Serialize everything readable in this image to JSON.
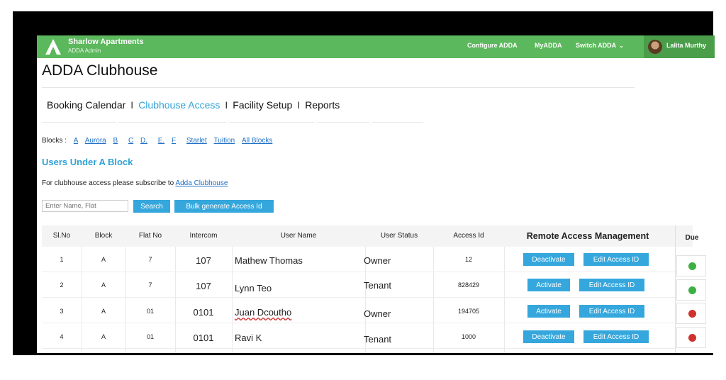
{
  "header": {
    "brand_name": "Sharlow Apartments",
    "brand_sub": "ADDA Admin",
    "nav": [
      "Configure ADDA",
      "MyADDA",
      "Switch ADDA"
    ],
    "user_name": "Lalita Murthy",
    "bar_color": "#5cb85c"
  },
  "page": {
    "title": "ADDA Clubhouse"
  },
  "tabs": [
    "Booking Calendar",
    "Clubhouse Access",
    "Facility Setup",
    "Reports"
  ],
  "tab_separator": "I",
  "active_tab": "Clubhouse Access",
  "blocks": {
    "label": "Blocks :",
    "items": [
      "A",
      "Aurora",
      "B",
      "C",
      "D.",
      "E.",
      "F",
      "Starlet",
      "Tuition",
      "All Blocks"
    ]
  },
  "section_title": "Users Under A Block",
  "subscribe": {
    "text": "For clubhouse access please subscribe to",
    "link": "Adda Clubhouse"
  },
  "search": {
    "placeholder": "Enter Name, Flat",
    "button": "Search",
    "bulk_button": "Bulk generate Access Id"
  },
  "table": {
    "columns": [
      "Sl.No",
      "Block",
      "Flat No",
      "Intercom",
      "User Name",
      "User Status",
      "Access Id",
      "Remote Access Management"
    ],
    "due_label": "Due",
    "edit_label": "Edit Access ID",
    "rows": [
      {
        "sl": "1",
        "block": "A",
        "flat": "7",
        "intercom": "107",
        "name": "Mathew Thomas",
        "status": "Owner",
        "access_id": "12",
        "action": "Deactivate",
        "due": "green"
      },
      {
        "sl": "2",
        "block": "A",
        "flat": "7",
        "intercom": "107",
        "name": "Lynn Teo",
        "status": "Tenant",
        "access_id": "828429",
        "action": "Activate",
        "due": "green"
      },
      {
        "sl": "3",
        "block": "A",
        "flat": "01",
        "intercom": "0101",
        "name": "Juan Dcoutho",
        "status": "Owner",
        "access_id": "194705",
        "action": "Activate",
        "due": "red"
      },
      {
        "sl": "4",
        "block": "A",
        "flat": "01",
        "intercom": "0101",
        "name": "Ravi K",
        "status": "Tenant",
        "access_id": "1000",
        "action": "Deactivate",
        "due": "red"
      }
    ]
  },
  "colors": {
    "accent": "#2fa2d6",
    "button": "#35a7dc",
    "due_green": "#3cb043",
    "due_red": "#d0322c"
  }
}
